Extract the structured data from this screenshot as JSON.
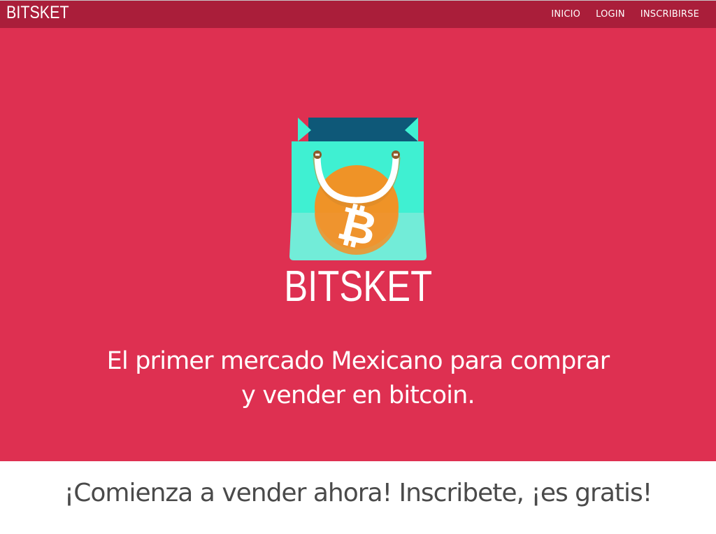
{
  "navbar": {
    "brand": "BITSKET",
    "links": [
      {
        "label": "INICIO"
      },
      {
        "label": "LOGIN"
      },
      {
        "label": "INSCRIBIRSE"
      }
    ]
  },
  "hero": {
    "logo_text": "BITSKET",
    "tagline_line1": "El primer mercado Mexicano para comprar",
    "tagline_line2": "y vender en bitcoin.",
    "logo_symbol": "₿"
  },
  "cta": {
    "text": "¡Comienza a vender ahora! Inscribete, ¡es gratis!"
  },
  "colors": {
    "navbar": "#aa1e3a",
    "hero": "#de3051",
    "bag_top": "#3ff0d2",
    "bag_bottom": "#72ecd8",
    "bag_inner": "#0e5878",
    "coin": "#ef9327",
    "cta_text": "#4a4a4a"
  },
  "icons": {
    "logo": "shopping-bag-bitcoin-icon"
  }
}
